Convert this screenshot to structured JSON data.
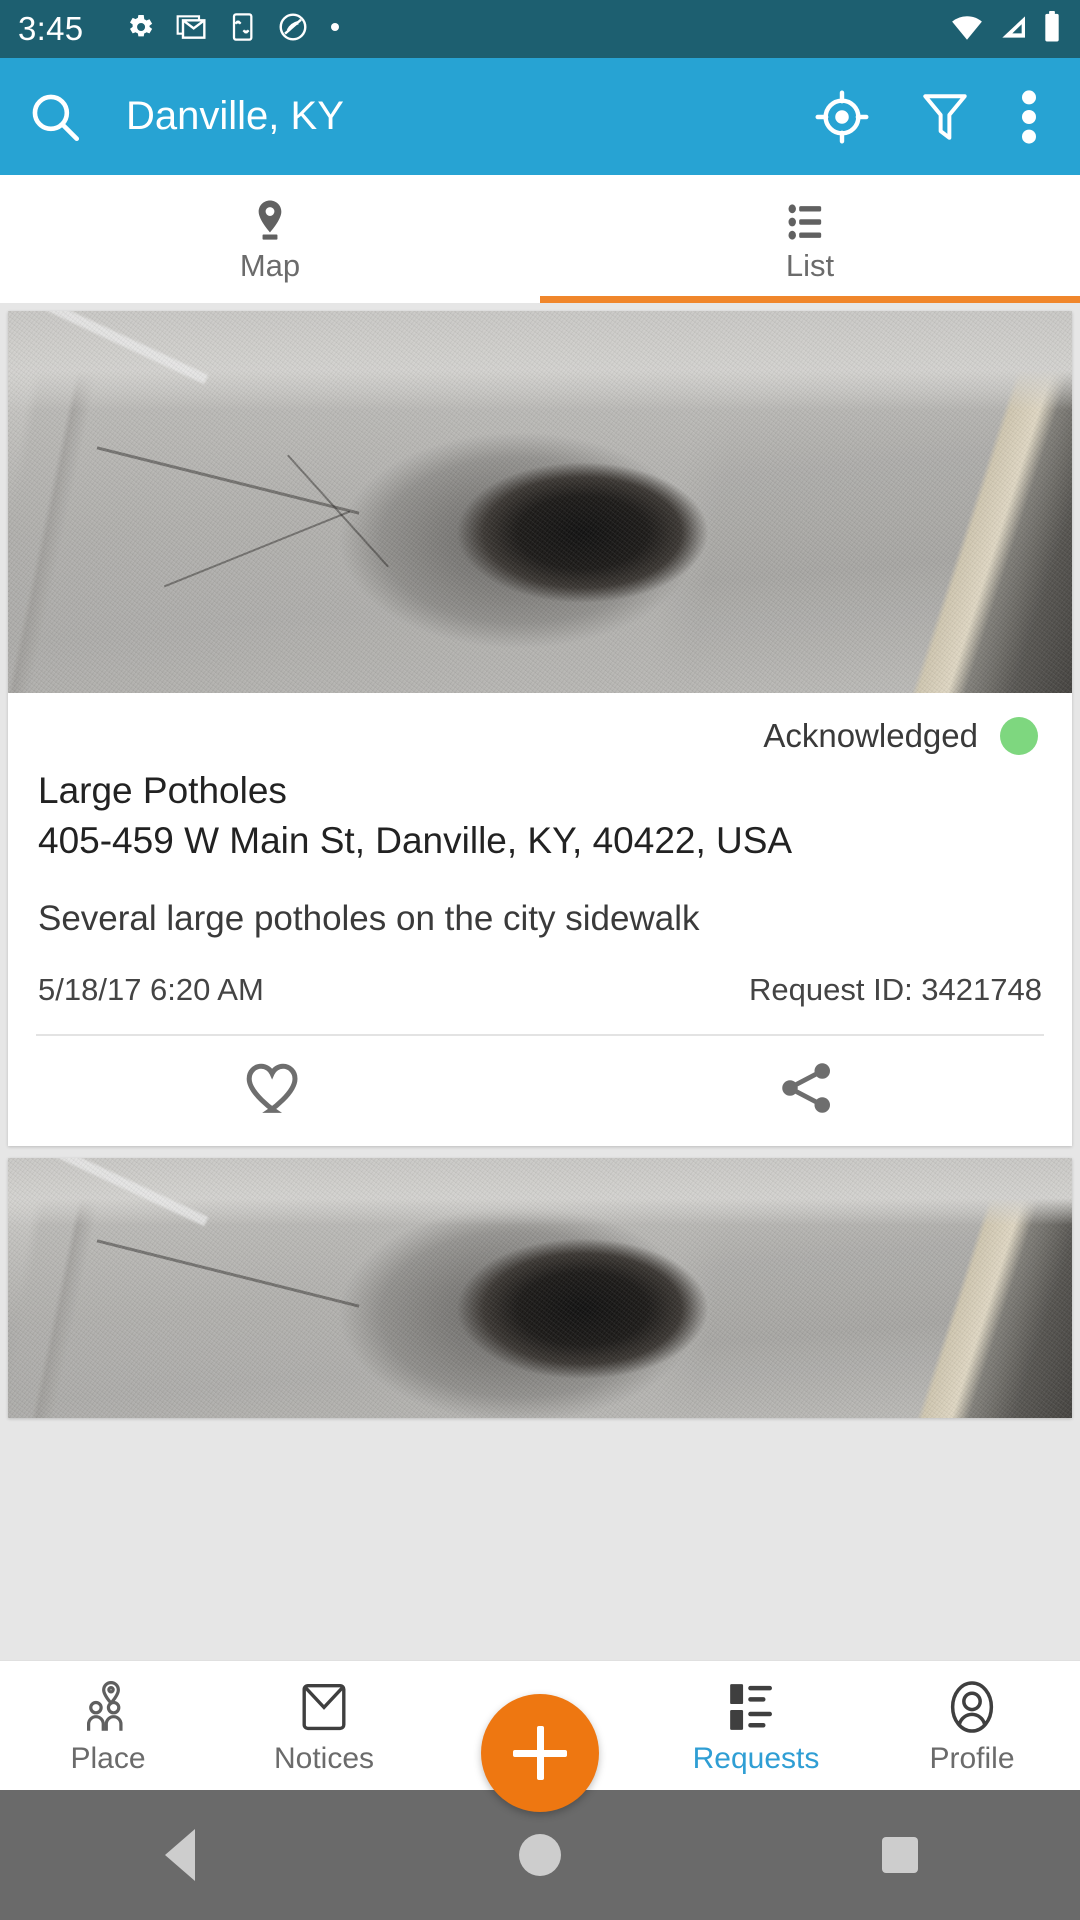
{
  "statusbar": {
    "time": "3:45",
    "left_icons": [
      "settings-gear-icon",
      "gmail-icon",
      "sync-transfer-icon",
      "do-not-disturb-icon",
      "dot-icon"
    ],
    "right_icons": [
      "wifi-icon",
      "cell-signal-icon",
      "battery-icon"
    ]
  },
  "appbar": {
    "title": "Danville, KY",
    "search_icon": "search-icon",
    "locate_icon": "my-location-icon",
    "filter_icon": "filter-funnel-icon",
    "overflow_icon": "overflow-menu-icon",
    "background_color": "#27a3d3"
  },
  "tabs": {
    "active_index": 1,
    "indicator_color": "#f0862b",
    "items": [
      {
        "label": "Map",
        "icon": "map-pin-icon"
      },
      {
        "label": "List",
        "icon": "list-icon"
      }
    ]
  },
  "requests": [
    {
      "status": "Acknowledged",
      "status_color": "#7ed77f",
      "title": "Large Potholes",
      "address": "405-459 W Main St, Danville, KY, 40422, USA",
      "description": "Several large potholes on the city sidewalk",
      "date": "5/18/17 6:20 AM",
      "request_id": "Request ID: 3421748",
      "like_icon": "heart-outline-icon",
      "share_icon": "share-icon",
      "photo_alt": "pothole-photo"
    },
    {
      "photo_alt": "pothole-photo"
    }
  ],
  "bottomnav": {
    "active_label": "Requests",
    "active_color": "#2f9ed4",
    "fab": {
      "icon": "plus-icon",
      "color": "#ee7711"
    },
    "items": [
      {
        "label": "Place",
        "icon": "place-people-icon",
        "active": false
      },
      {
        "label": "Notices",
        "icon": "envelope-icon",
        "active": false
      },
      {
        "label": "Requests",
        "icon": "requests-list-icon",
        "active": true
      },
      {
        "label": "Profile",
        "icon": "profile-person-icon",
        "active": false
      }
    ]
  },
  "androidnav": {
    "back_icon": "back-triangle-icon",
    "home_icon": "home-circle-icon",
    "recents_icon": "recents-square-icon"
  }
}
